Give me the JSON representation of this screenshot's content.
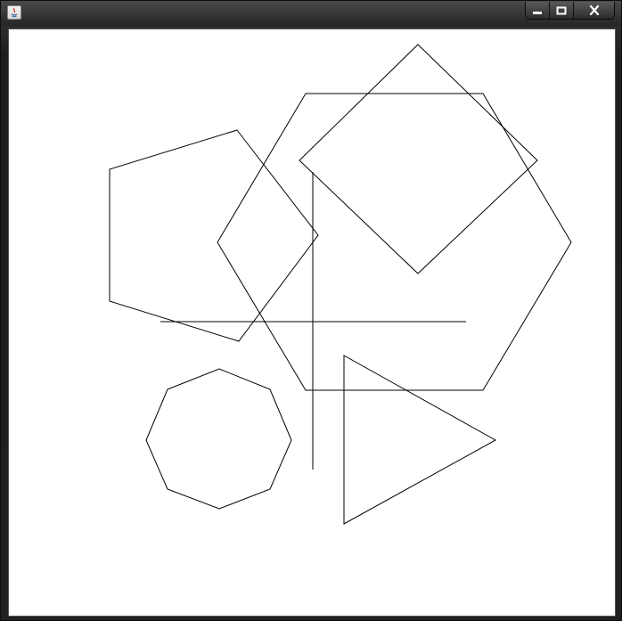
{
  "window": {
    "title": "",
    "controls": {
      "minimize_icon": "minimize-icon",
      "maximize_icon": "maximize-icon",
      "close_icon": "close-icon"
    }
  },
  "canvas": {
    "background": "#ffffff",
    "stroke": "#000000",
    "shapes": [
      {
        "name": "pentagon-outline",
        "kind": "polygon"
      },
      {
        "name": "large-hexagon-outline",
        "kind": "polygon"
      },
      {
        "name": "diamond-outline",
        "kind": "polygon"
      },
      {
        "name": "octagon-outline",
        "kind": "polygon"
      },
      {
        "name": "triangle-outline",
        "kind": "polygon"
      },
      {
        "name": "horizontal-line",
        "kind": "line"
      },
      {
        "name": "vertical-line",
        "kind": "line"
      }
    ]
  }
}
